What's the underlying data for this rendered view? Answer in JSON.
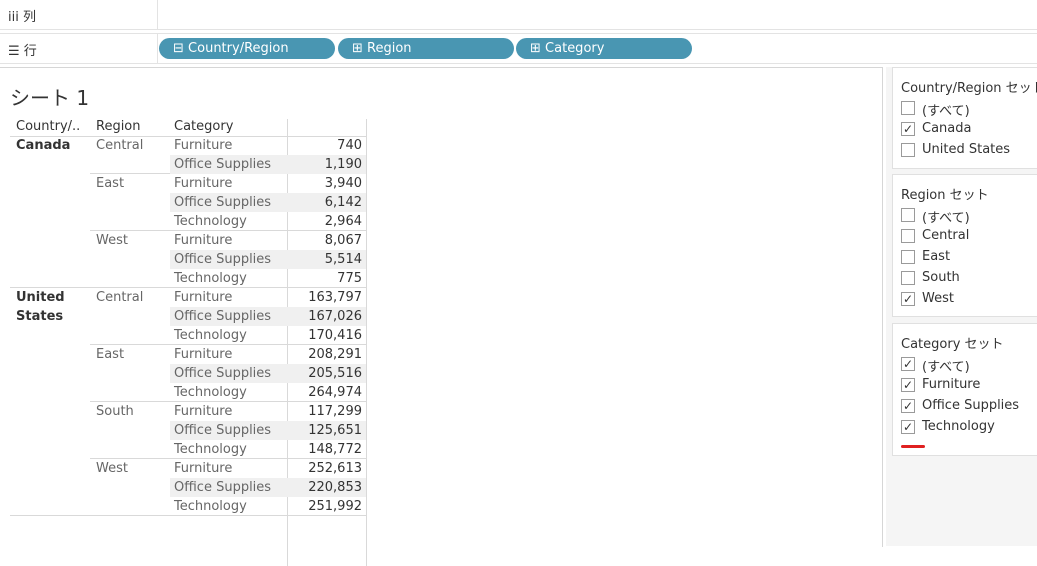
{
  "shelves": {
    "columns": {
      "icon": "iii",
      "label": "列"
    },
    "rows": {
      "icon": "☰",
      "label": "行",
      "pills": [
        {
          "prefix": "⊟",
          "label": "Country/Region"
        },
        {
          "prefix": "⊞",
          "label": "Region"
        },
        {
          "prefix": "⊞",
          "label": "Category"
        }
      ]
    }
  },
  "sheet": {
    "title": "シート 1",
    "headers": {
      "country": "Country/..",
      "region": "Region",
      "category": "Category"
    },
    "countries": [
      "Canada",
      "United",
      "States"
    ],
    "regions": [
      "Central",
      "East",
      "West",
      "Central",
      "East",
      "South",
      "West"
    ],
    "rows": [
      {
        "category": "Furniture",
        "value": "740"
      },
      {
        "category": "Office Supplies",
        "value": "1,190"
      },
      {
        "category": "Furniture",
        "value": "3,940"
      },
      {
        "category": "Office Supplies",
        "value": "6,142"
      },
      {
        "category": "Technology",
        "value": "2,964"
      },
      {
        "category": "Furniture",
        "value": "8,067"
      },
      {
        "category": "Office Supplies",
        "value": "5,514"
      },
      {
        "category": "Technology",
        "value": "775"
      },
      {
        "category": "Furniture",
        "value": "163,797"
      },
      {
        "category": "Office Supplies",
        "value": "167,026"
      },
      {
        "category": "Technology",
        "value": "170,416"
      },
      {
        "category": "Furniture",
        "value": "208,291"
      },
      {
        "category": "Office Supplies",
        "value": "205,516"
      },
      {
        "category": "Technology",
        "value": "264,974"
      },
      {
        "category": "Furniture",
        "value": "117,299"
      },
      {
        "category": "Office Supplies",
        "value": "125,651"
      },
      {
        "category": "Technology",
        "value": "148,772"
      },
      {
        "category": "Furniture",
        "value": "252,613"
      },
      {
        "category": "Office Supplies",
        "value": "220,853"
      },
      {
        "category": "Technology",
        "value": "251,992"
      }
    ]
  },
  "filters": [
    {
      "title": "Country/Region セット",
      "options": [
        {
          "label": "(すべて)",
          "checked": false
        },
        {
          "label": "Canada",
          "checked": true
        },
        {
          "label": "United States",
          "checked": false
        }
      ]
    },
    {
      "title": "Region セット",
      "options": [
        {
          "label": "(すべて)",
          "checked": false
        },
        {
          "label": "Central",
          "checked": false
        },
        {
          "label": "East",
          "checked": false
        },
        {
          "label": "South",
          "checked": false
        },
        {
          "label": "West",
          "checked": true
        }
      ]
    },
    {
      "title": "Category セット",
      "options": [
        {
          "label": "(すべて)",
          "checked": true
        },
        {
          "label": "Furniture",
          "checked": true
        },
        {
          "label": "Office Supplies",
          "checked": true
        },
        {
          "label": "Technology",
          "checked": true
        }
      ]
    }
  ],
  "colors": {
    "pill": "#4996b2",
    "annotation": "#e02020",
    "band": "#f0f0f0"
  }
}
